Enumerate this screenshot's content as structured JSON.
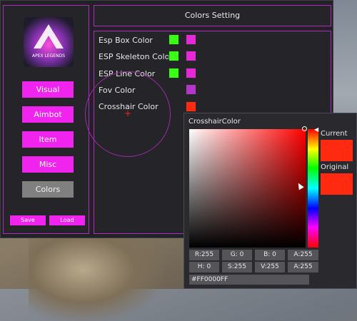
{
  "header": {
    "title": "Colors Setting"
  },
  "sidebar": {
    "logo_text": "APEX LEGENDS",
    "nav": [
      {
        "label": "Visual"
      },
      {
        "label": "Aimbot"
      },
      {
        "label": "Item"
      },
      {
        "label": "Misc"
      },
      {
        "label": "Colors"
      }
    ],
    "active": "Colors",
    "save_label": "Save",
    "load_label": "Load"
  },
  "colors": [
    {
      "label": "Esp Box Color",
      "swatches": [
        "#39ff14",
        "#e529d8"
      ]
    },
    {
      "label": "ESP Skeleton Color",
      "swatches": [
        "#39ff14",
        "#e529d8"
      ]
    },
    {
      "label": "ESP Line Color",
      "swatches": [
        "#39ff14",
        "#e529d8"
      ]
    },
    {
      "label": "Fov Color",
      "swatches": [
        "#b335c9"
      ]
    },
    {
      "label": "Crosshair Color",
      "swatches": [
        "#ff2a10"
      ]
    }
  ],
  "picker": {
    "title": "CrosshairColor",
    "current_label": "Current",
    "original_label": "Original",
    "current_color": "#ff2a10",
    "original_color": "#ff2a10",
    "rgba": [
      "R:255",
      "G:  0",
      "B:  0",
      "A:255"
    ],
    "hsva": [
      "H:  0",
      "S:255",
      "V:255",
      "A:255"
    ],
    "hex": "#FF0000FF"
  },
  "accent": "#f123ef"
}
